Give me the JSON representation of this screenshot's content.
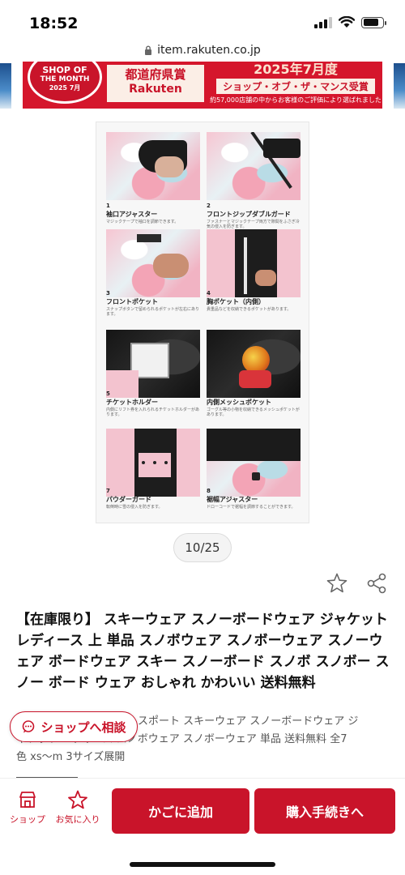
{
  "status_bar": {
    "time": "18:52"
  },
  "browser": {
    "url": "item.rakuten.co.jp"
  },
  "banner": {
    "badge_line1": "SHOP OF",
    "badge_line2": "THE MONTH",
    "badge_line3": "2025 7月",
    "award_title": "都道府県賞",
    "brand": "Rakuten",
    "headline": "2025年7月度",
    "subhead": "ショップ・オブ・ザ・マンス受賞",
    "note": "約57,000店舗の中からお客様のご評価により選ばれました"
  },
  "gallery": {
    "features": [
      {
        "num": "1",
        "title": "袖口アジャスター",
        "desc": "マジックテープで袖口を調節できます。"
      },
      {
        "num": "2",
        "title": "フロントジップダブルガード",
        "desc": "ファスナーとマジックテープ両方で隙間をふさぎ冷気の侵入を防ぎます。"
      },
      {
        "num": "3",
        "title": "フロントポケット",
        "desc": "スナップボタンで留められるポケットが左右にあります。"
      },
      {
        "num": "4",
        "title": "胸ポケット（内側）",
        "desc": "貴重品などを収納できるポケットがあります。"
      },
      {
        "num": "5",
        "title": "チケットホルダー",
        "desc": "内側にリフト券を入れられるチケットホルダーがあります。"
      },
      {
        "num": "6",
        "title": "内側メッシュポケット",
        "desc": "ゴーグル等の小物を収納できるメッシュポケットがあります。"
      },
      {
        "num": "7",
        "title": "パウダーガード",
        "desc": "転倒時に雪の侵入を防ぎます。"
      },
      {
        "num": "8",
        "title": "裾幅アジャスター",
        "desc": "ドローコードで裾幅を調節することができます。"
      }
    ],
    "page_indicator": "10/25"
  },
  "product": {
    "title": "【在庫限り】 スキーウェア スノーボードウェア ジャケット レディース 上 単品 スノボウェア スノボーウェア スノーウェア ボードウェア スキー スノーボード スノボ スノボー スノー ボード ウェア おしゃれ かわいい 送料無料",
    "subtitle_visible": "スポート スキーウェア スノーボードウェア ジ",
    "subtitle_line2": "ャケット レディース スノボウェア スノボーウェア 単品 送料無料 全7",
    "subtitle_line3": "色 xs〜m 3サイズ展開"
  },
  "consult": {
    "label": "ショップへ相談"
  },
  "bottom_bar": {
    "shop_label": "ショップ",
    "favorite_label": "お気に入り",
    "add_to_cart": "かごに追加",
    "checkout": "購入手続きへ"
  },
  "colors": {
    "brand_red": "#c9142a",
    "banner_red": "#d5162c"
  }
}
